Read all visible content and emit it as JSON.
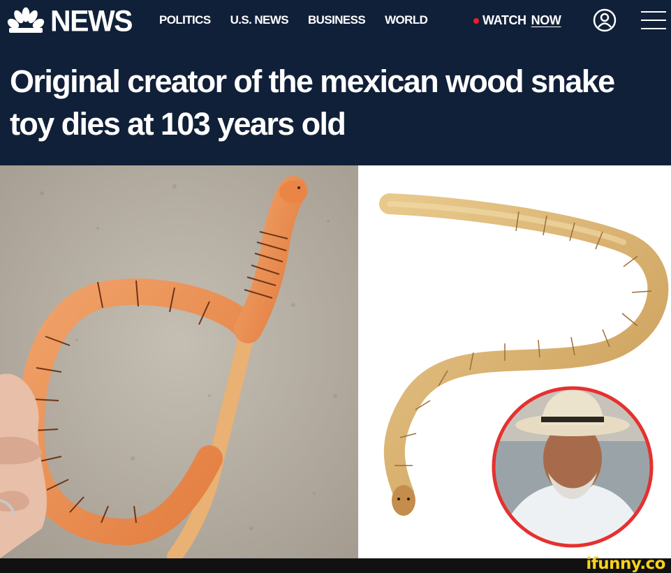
{
  "header": {
    "logo_text": "NEWS",
    "nav": [
      "POLITICS",
      "U.S. NEWS",
      "BUSINESS",
      "WORLD"
    ],
    "watch_label": "WATCH",
    "watch_now": "NOW",
    "icons": {
      "logo": "peacock-logo",
      "account": "account-icon",
      "menu": "hamburger-menu-icon"
    },
    "colors": {
      "background": "#112039",
      "live_dot": "#e8202a",
      "text": "#ffffff"
    }
  },
  "article": {
    "headline_line1": "Original creator of the mexican wood snake",
    "headline_line2": "toy dies at 103 years old"
  },
  "watermark": "ifunny.co"
}
